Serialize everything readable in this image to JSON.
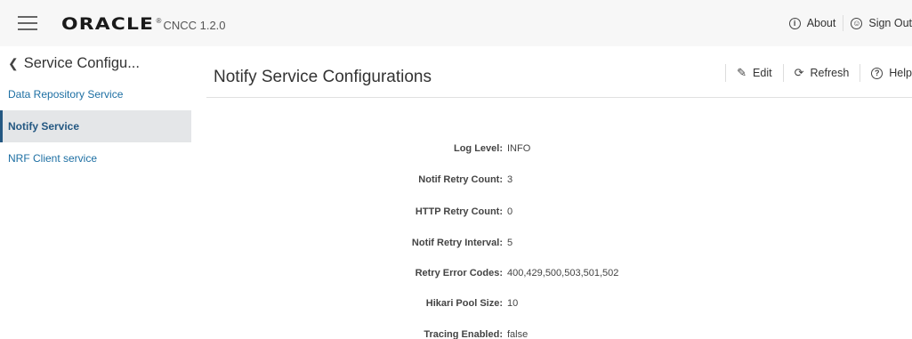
{
  "header": {
    "brand_logo": "ORACLE",
    "brand_reg": "®",
    "product": "CNCC 1.2.0",
    "actions": [
      {
        "label": "About",
        "icon": "info-icon"
      },
      {
        "label": "Sign Out",
        "icon": "user-icon"
      }
    ]
  },
  "sidebar": {
    "back_label": "Service Configu...",
    "items": [
      {
        "label": "Data Repository Service",
        "active": false
      },
      {
        "label": "Notify Service",
        "active": true
      },
      {
        "label": "NRF Client service",
        "active": false
      }
    ]
  },
  "main": {
    "title": "Notify Service Configurations",
    "toolbar": {
      "edit_label": "Edit",
      "refresh_label": "Refresh",
      "help_label": "Help"
    },
    "fields": [
      {
        "label": "Log Level:",
        "value": "INFO"
      },
      {
        "label": "Notif Retry Count:",
        "value": "3"
      },
      {
        "label": "HTTP Retry Count:",
        "value": "0"
      },
      {
        "label": "Notif Retry Interval:",
        "value": "5"
      },
      {
        "label": "Retry Error Codes:",
        "value": "400,429,500,503,501,502"
      },
      {
        "label": "Hikari Pool Size:",
        "value": "10"
      },
      {
        "label": "Tracing Enabled:",
        "value": "false"
      }
    ]
  }
}
